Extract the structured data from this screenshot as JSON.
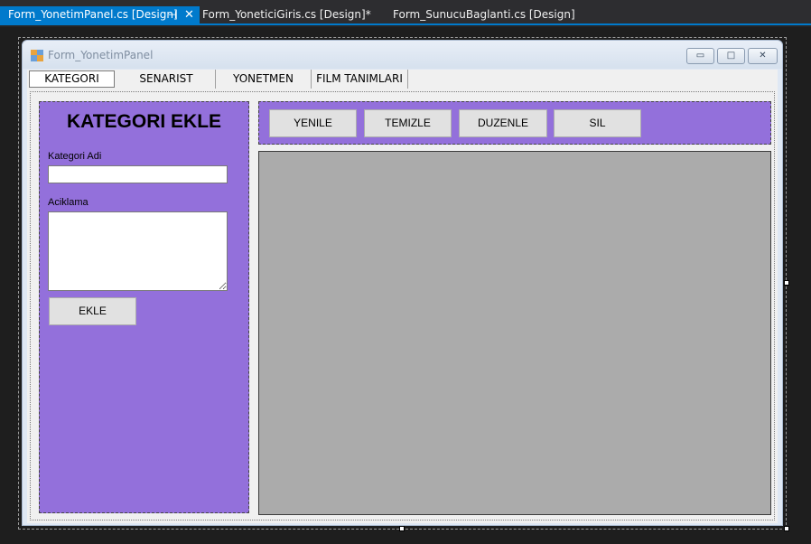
{
  "ide": {
    "tabs": [
      {
        "label": "Form_YonetimPanel.cs [Design]"
      },
      {
        "label": "Form_YoneticiGiris.cs [Design]*"
      },
      {
        "label": "Form_SunucuBaglanti.cs [Design]"
      }
    ],
    "pin_glyph": "⊣",
    "close_glyph": "✕"
  },
  "form": {
    "title": "Form_YonetimPanel",
    "minimize_glyph": "▭",
    "maximize_glyph": "□",
    "close_glyph": "✕"
  },
  "form_tabs": [
    {
      "label": "KATEGORI"
    },
    {
      "label": "SENARIST"
    },
    {
      "label": "YONETMEN"
    },
    {
      "label": "FILM TANIMLARI"
    }
  ],
  "category_panel": {
    "title": "KATEGORI EKLE",
    "name_label": "Kategori Adi",
    "name_value": "",
    "description_label": "Aciklama",
    "description_value": "",
    "add_button": "EKLE"
  },
  "toolbar": {
    "refresh": "YENILE",
    "clear": "TEMIZLE",
    "edit": "DUZENLE",
    "delete": "SIL"
  },
  "colors": {
    "panel_purple": "#9370db",
    "ide_accent": "#007acc",
    "grid_background": "#ababab"
  }
}
